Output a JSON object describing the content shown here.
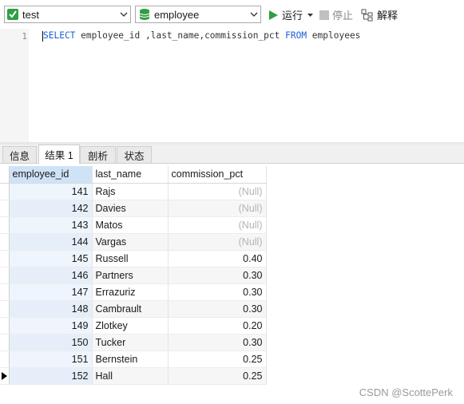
{
  "toolbar": {
    "connection": "test",
    "database": "employee",
    "run_label": "运行",
    "stop_label": "停止",
    "explain_label": "解释"
  },
  "editor": {
    "line_number": "1",
    "code_keyword_select": "SELECT",
    "code_columns": " employee_id ,last_name,commission_pct ",
    "code_keyword_from": "FROM",
    "code_table": " employees"
  },
  "tabs": [
    "信息",
    "结果 1",
    "剖析",
    "状态"
  ],
  "grid": {
    "headers": [
      "employee_id",
      "last_name",
      "commission_pct"
    ],
    "rows": [
      [
        "141",
        "Rajs",
        "(Null)"
      ],
      [
        "142",
        "Davies",
        "(Null)"
      ],
      [
        "143",
        "Matos",
        "(Null)"
      ],
      [
        "144",
        "Vargas",
        "(Null)"
      ],
      [
        "145",
        "Russell",
        "0.40"
      ],
      [
        "146",
        "Partners",
        "0.30"
      ],
      [
        "147",
        "Errazuriz",
        "0.30"
      ],
      [
        "148",
        "Cambrault",
        "0.30"
      ],
      [
        "149",
        "Zlotkey",
        "0.20"
      ],
      [
        "150",
        "Tucker",
        "0.30"
      ],
      [
        "151",
        "Bernstein",
        "0.25"
      ],
      [
        "152",
        "Hall",
        "0.25"
      ]
    ]
  },
  "watermark": "CSDN @ScottePerk",
  "colors": {
    "accent": "#1c5fd6",
    "run_green": "#2ea043",
    "null_gray": "#b4b4b4"
  }
}
